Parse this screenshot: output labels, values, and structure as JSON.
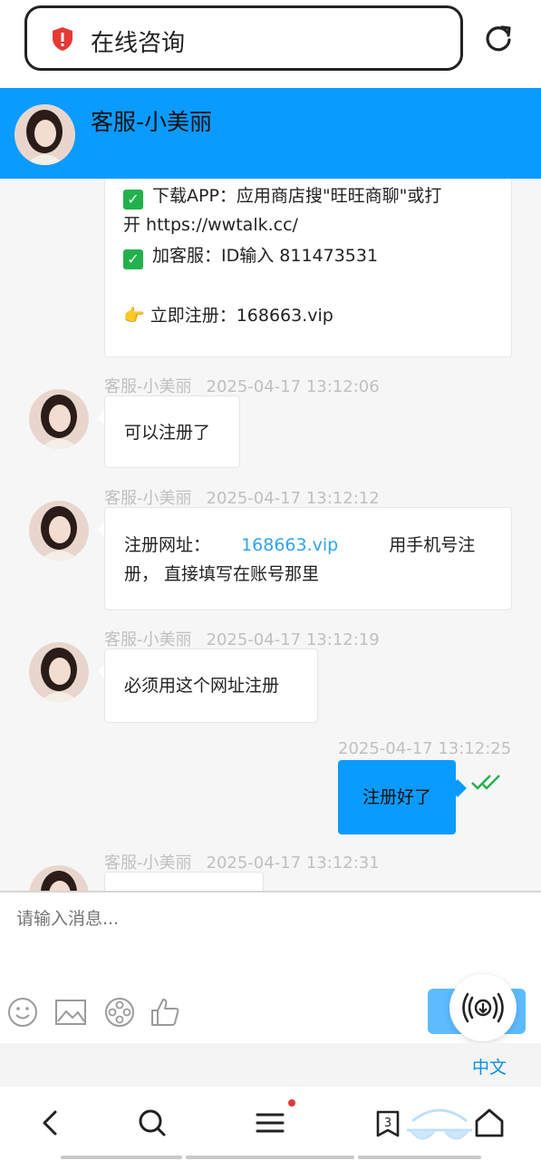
{
  "browser": {
    "page_title": "在线咨询",
    "tab_count": "3"
  },
  "chat": {
    "agent_name": "客服-小美丽"
  },
  "messages": {
    "intro": {
      "line1": "下载APP：应用商店搜\"旺旺商聊\"或打",
      "line2": "开 https://wwtalk.cc/",
      "line3": "加客服：ID输入 811473531",
      "line4": "👉 立即注册：168663.vip"
    },
    "m1": {
      "sender": "客服-小美丽",
      "time": "2025-04-17 13:12:06",
      "text": "可以注册了"
    },
    "m2": {
      "sender": "客服-小美丽",
      "time": "2025-04-17 13:12:12",
      "label": "注册网址：",
      "link": "168663.vip",
      "after_link": "用手机号注",
      "line2": "册， 直接填写在账号那里"
    },
    "m3": {
      "sender": "客服-小美丽",
      "time": "2025-04-17 13:12:19",
      "text": "必须用这个网址注册"
    },
    "m4": {
      "time": "2025-04-17 13:12:25",
      "text": "注册好了"
    },
    "m5": {
      "sender": "客服-小美丽",
      "time": "2025-04-17 13:12:31"
    }
  },
  "input": {
    "placeholder": "请输入消息..."
  },
  "language": "中文",
  "colors": {
    "accent": "#0a9bff",
    "link": "#2ea4f2",
    "check": "#22b14c"
  }
}
